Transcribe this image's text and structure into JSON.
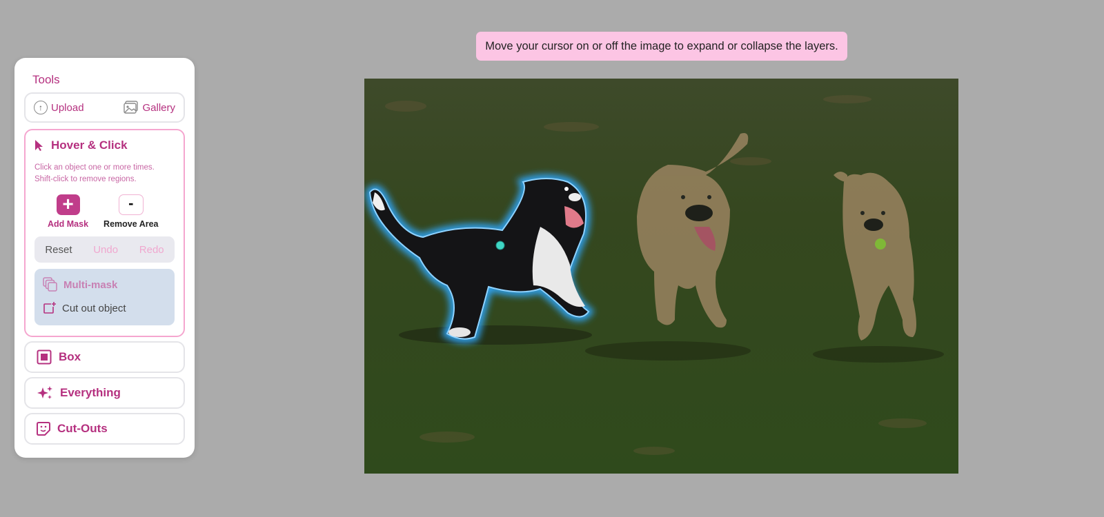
{
  "banner": {
    "text": "Move your cursor on or off the image to expand or collapse the layers."
  },
  "tools": {
    "title": "Tools",
    "upload_label": "Upload",
    "gallery_label": "Gallery",
    "hover_click": {
      "title": "Hover & Click",
      "hint_line1": "Click an object one or more times.",
      "hint_line2": "Shift-click to remove regions.",
      "add_mask_label": "Add Mask",
      "remove_area_label": "Remove Area",
      "add_symbol": "+",
      "remove_symbol": "-",
      "reset_label": "Reset",
      "undo_label": "Undo",
      "redo_label": "Redo",
      "multimask_label": "Multi-mask",
      "cutout_label": "Cut out object"
    },
    "box_label": "Box",
    "everything_label": "Everything",
    "cutouts_label": "Cut-Outs"
  },
  "colors": {
    "accent": "#b5307f",
    "accent_fill": "#c03d8a",
    "disabled": "#f0a8cf",
    "banner_bg": "#fcc5e4",
    "page_bg": "#ababab",
    "mask_glow": "#2fa8ff",
    "click_point": "#3fd6c4"
  },
  "icons": {
    "upload": "upload-icon",
    "gallery": "gallery-icon",
    "pointer": "cursor-arrow-icon",
    "multimask": "layers-icon",
    "cutout": "crop-add-icon",
    "box": "square-icon",
    "everything": "sparkles-icon",
    "cutouts": "sticker-icon"
  }
}
